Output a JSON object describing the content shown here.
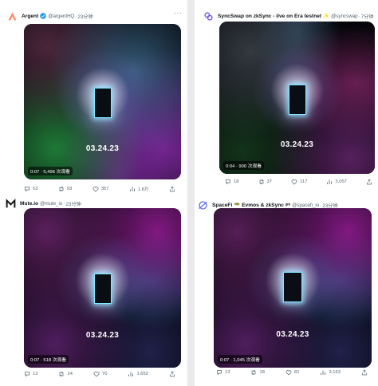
{
  "colors": {
    "handle": "#536471",
    "verified": "#1d9bf0",
    "argent_brand": "#ff875b",
    "syncswap_brand": "#7b5cf0",
    "spacefi_brand": "#5b6cf0"
  },
  "posts": [
    {
      "name": "Argent",
      "handle": "@argentHQ",
      "separator": "·",
      "time": "23分钟",
      "avatar_icon": "argent-logo-icon",
      "video": {
        "date": "03.24.23",
        "meta": "0:07 · 5,496 次观看"
      },
      "replies": "53",
      "reposts": "93",
      "likes": "357",
      "views": "1.8万"
    },
    {
      "name": "SyncSwap on zkSync - live on Era testnet ✨",
      "handle": "@syncswap",
      "separator": "·",
      "time": "7分钟",
      "avatar_icon": "syncswap-logo-icon",
      "video": {
        "date": "03.24.23",
        "meta": "0:04 · 900 次观看"
      },
      "replies": "18",
      "reposts": "37",
      "likes": "117",
      "views": "3,057"
    },
    {
      "name": "Mute.io",
      "handle": "@mute_io",
      "separator": "·",
      "time": "23分钟",
      "avatar_icon": "mute-logo-icon",
      "video": {
        "date": "03.24.23",
        "meta": "0:07 · 518 次观看"
      },
      "replies": "13",
      "reposts": "24",
      "likes": "70",
      "views": "1,652"
    },
    {
      "name": "SpaceFi 🥗 Evmos & zkSync ᵍᵐ",
      "handle": "@spacefi_io",
      "separator": "·",
      "time": "23分钟",
      "avatar_icon": "spacefi-logo-icon",
      "video": {
        "date": "03.24.23",
        "meta": "0:07 · 1,045 次观看"
      },
      "replies": "13",
      "reposts": "18",
      "likes": "81",
      "views": "3,163"
    }
  ]
}
